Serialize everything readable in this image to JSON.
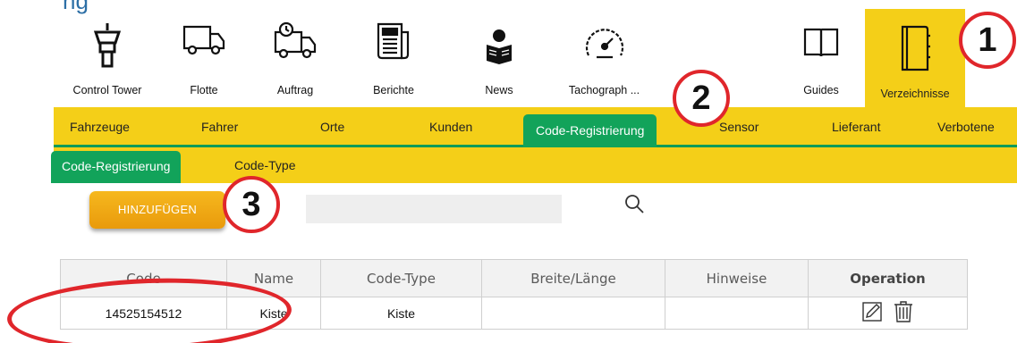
{
  "toolbar": {
    "items": [
      {
        "label": "Control Tower",
        "icon": "control-tower-icon"
      },
      {
        "label": "Flotte",
        "icon": "truck-icon"
      },
      {
        "label": "Auftrag",
        "icon": "truck-clock-icon"
      },
      {
        "label": "Berichte",
        "icon": "newspaper-icon"
      },
      {
        "label": "News",
        "icon": "reader-icon"
      },
      {
        "label": "Tachograph ...",
        "icon": "tachograph-icon"
      },
      {
        "label": "Guides",
        "icon": "book-icon"
      },
      {
        "label": "Verzeichnisse",
        "icon": "notebook-icon"
      }
    ],
    "active": "Verzeichnisse"
  },
  "main_tabs": [
    "Fahrzeuge",
    "Fahrer",
    "Orte",
    "Kunden",
    "Code-Registrierung",
    "Sensor",
    "Lieferant",
    "Verbotene"
  ],
  "sub_tabs": [
    "Code-Registrierung",
    "Code-Type"
  ],
  "actions": {
    "add_label": "HINZUFÜGEN",
    "search_value": ""
  },
  "table": {
    "headers": [
      "Code",
      "Name",
      "Code-Type",
      "Breite/Länge",
      "Hinweise",
      "Operation"
    ],
    "rows": [
      {
        "code": "14525154512",
        "name": "Kiste",
        "code_type": "Kiste",
        "coords": "",
        "notes": ""
      }
    ]
  },
  "annotations": {
    "step1": "1",
    "step2": "2",
    "step3": "3"
  },
  "colors": {
    "accent_yellow": "#f4cf18",
    "active_green": "#12a35a",
    "marker_red": "#e0262b",
    "button_orange": "#f0aa14"
  }
}
